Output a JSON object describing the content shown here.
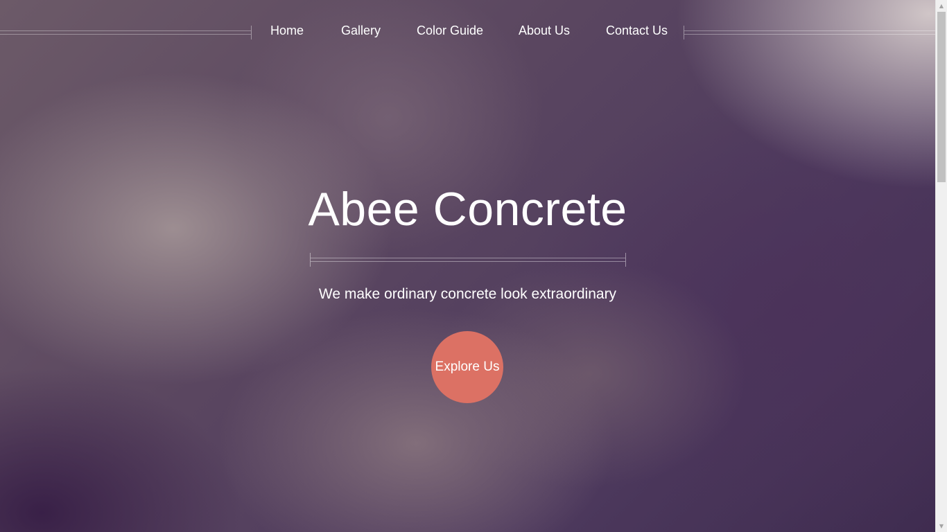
{
  "nav": {
    "items": [
      {
        "label": "Home"
      },
      {
        "label": "Gallery"
      },
      {
        "label": "Color Guide"
      },
      {
        "label": "About Us"
      },
      {
        "label": "Contact Us"
      }
    ]
  },
  "hero": {
    "title": "Abee Concrete",
    "subtitle": "We make ordinary concrete look extraordinary",
    "cta_label": "Explore Us"
  },
  "colors": {
    "accent": "#dc7164",
    "background": "#4a3558",
    "text": "#ffffff"
  },
  "scrollbar": {
    "up_icon": "arrow-up-icon",
    "down_icon": "arrow-down-icon"
  }
}
